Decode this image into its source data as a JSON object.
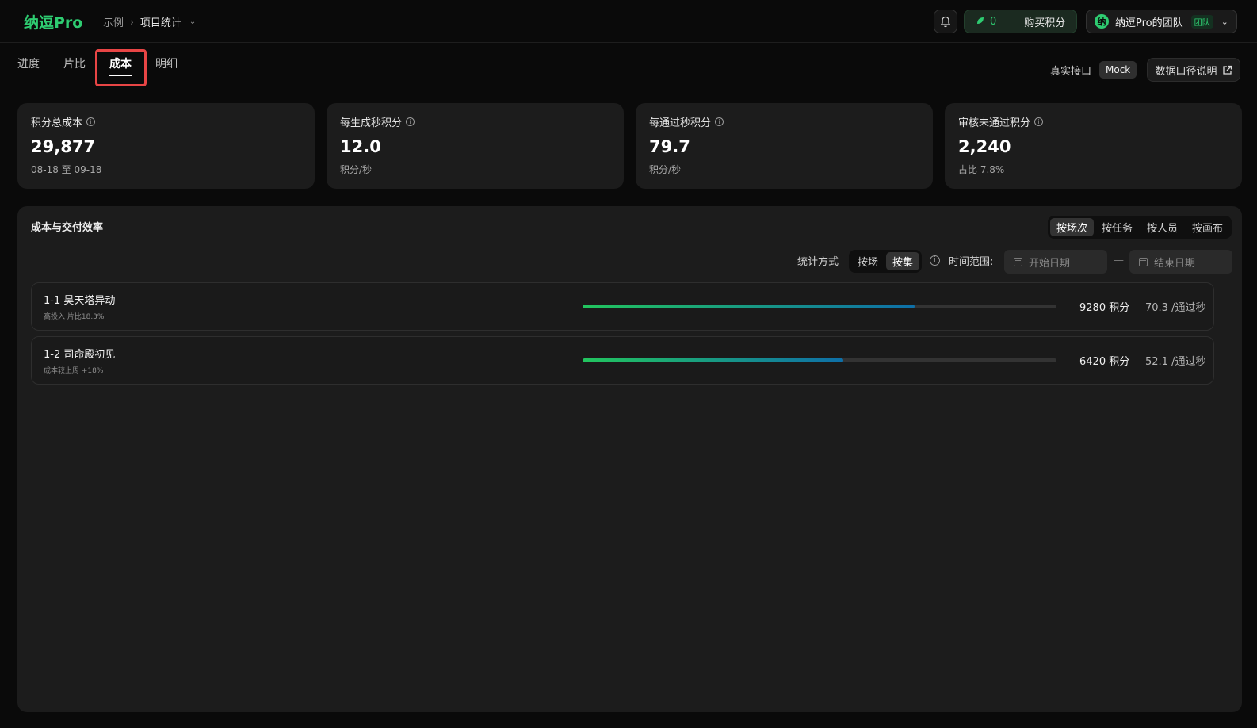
{
  "app": {
    "logo": "纳逗Pro"
  },
  "breadcrumb": {
    "parent": "示例",
    "separator": "›",
    "current": "项目统计",
    "caret": "⌄"
  },
  "header": {
    "points_value": "0",
    "buy_label": "购买积分",
    "team_avatar": "纳",
    "team_name": "纳逗Pro的团队",
    "team_badge": "团队",
    "chevron": "⌄"
  },
  "tabs": [
    {
      "label": "进度",
      "active": false
    },
    {
      "label": "片比",
      "active": false
    },
    {
      "label": "成本",
      "active": true
    },
    {
      "label": "明细",
      "active": false
    }
  ],
  "api": {
    "real_label": "真实接口",
    "mock_label": "Mock",
    "doc_label": "数据口径说明"
  },
  "cards": [
    {
      "label": "积分总成本",
      "value": "29,877",
      "sub": "08-18 至 09-18"
    },
    {
      "label": "每生成秒积分",
      "value": "12.0",
      "sub": "积分/秒"
    },
    {
      "label": "每通过秒积分",
      "value": "79.7",
      "sub": "积分/秒"
    },
    {
      "label": "审核未通过积分",
      "value": "2,240",
      "sub": "占比 7.8%"
    }
  ],
  "panel": {
    "title": "成本与交付效率",
    "group_options": [
      {
        "label": "按场次",
        "active": true
      },
      {
        "label": "按任务",
        "active": false
      },
      {
        "label": "按人员",
        "active": false
      },
      {
        "label": "按画布",
        "active": false
      }
    ],
    "stat_label": "统计方式",
    "stat_options": [
      {
        "label": "按场",
        "active": false
      },
      {
        "label": "按集",
        "active": true
      }
    ],
    "range_label": "时间范围:",
    "start_placeholder": "开始日期",
    "end_placeholder": "结束日期",
    "range_sep": "—",
    "rows": [
      {
        "title": "1-1 昊天塔异动",
        "sub": "高投入 片比18.3%",
        "progress": 0.7,
        "points": "9280 积分",
        "rate": "70.3 /通过秒"
      },
      {
        "title": "1-2 司命殿初见",
        "sub": "成本较上周 +18%",
        "progress": 0.55,
        "points": "6420 积分",
        "rate": "52.1 /通过秒"
      }
    ]
  },
  "colors": {
    "brand": "#2ecc71",
    "highlight": "#e84545",
    "bar_start": "#22c55e",
    "bar_end": "#0e6fa8"
  }
}
